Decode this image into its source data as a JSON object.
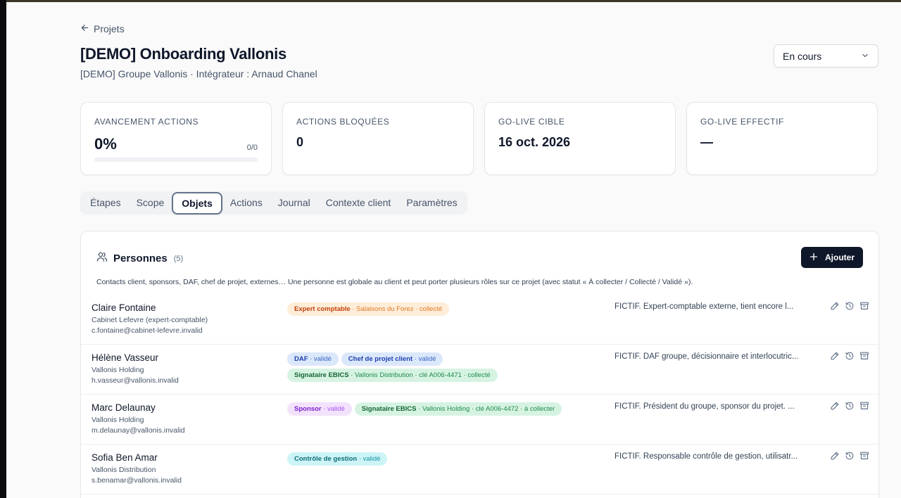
{
  "nav": {
    "back_label": "Projets"
  },
  "project": {
    "title": "[DEMO] Onboarding Vallonis",
    "subtitle": "[DEMO] Groupe Vallonis · Intégrateur : Arnaud Chanel",
    "status": "En cours"
  },
  "stats": [
    {
      "label": "Avancement actions",
      "value": "0%",
      "count": "0/0",
      "progress": 0
    },
    {
      "label": "Actions bloquées",
      "value": "0"
    },
    {
      "label": "Go-live cible",
      "value": "16 oct. 2026"
    },
    {
      "label": "Go-live effectif",
      "value": "—"
    }
  ],
  "tabs": [
    "Étapes",
    "Scope",
    "Objets",
    "Actions",
    "Journal",
    "Contexte client",
    "Paramètres"
  ],
  "active_tab": "Objets",
  "panel": {
    "title": "Personnes",
    "count": "(5)",
    "add_label": "Ajouter",
    "description": "Contacts client, sponsors, DAF, chef de projet, externes… Une personne est globale au client et peut porter plusieurs rôles sur ce projet (avec statut « À collecter / Collecté / Validé »)."
  },
  "people": [
    {
      "name": "Claire Fontaine",
      "org": "Cabinet Lefevre (expert-comptable)",
      "email": "c.fontaine@cabinet-lefevre.invalid",
      "tags": [
        {
          "role": "Expert comptable",
          "meta": " · Salaisons du Forez · collecté",
          "color": "orange"
        }
      ],
      "note": "FICTIF. Expert-comptable externe, tient encore l..."
    },
    {
      "name": "Hélène Vasseur",
      "org": "Vallonis Holding",
      "email": "h.vasseur@vallonis.invalid",
      "tags": [
        {
          "role": "DAF",
          "meta": " · validé",
          "color": "blue"
        },
        {
          "role": "Chef de projet client",
          "meta": " · validé",
          "color": "blue"
        },
        {
          "role": "Signataire EBICS",
          "meta": " · Vallonis Distribution · clé A006-4471 · collecté",
          "color": "green"
        }
      ],
      "note": "FICTIF. DAF groupe, décisionnaire et interlocutric..."
    },
    {
      "name": "Marc Delaunay",
      "org": "Vallonis Holding",
      "email": "m.delaunay@vallonis.invalid",
      "tags": [
        {
          "role": "Sponsor",
          "meta": " · validé",
          "color": "purple"
        },
        {
          "role": "Signataire EBICS",
          "meta": " · Vallonis Holding · clé A006-4472 · à collecter",
          "color": "green"
        }
      ],
      "note": "FICTIF. Président du groupe, sponsor du projet. ..."
    },
    {
      "name": "Sofia Ben Amar",
      "org": "Vallonis Distribution",
      "email": "s.benamar@vallonis.invalid",
      "tags": [
        {
          "role": "Contrôle de gestion",
          "meta": " · validé",
          "color": "cyan"
        }
      ],
      "note": "FICTIF. Responsable contrôle de gestion, utilisatr..."
    }
  ],
  "icons": {
    "back": "arrow-left-icon",
    "status": "chevron-down-icon",
    "panel": "users-icon",
    "add": "plus-icon",
    "row_actions": [
      "edit-icon",
      "history-icon",
      "archive-icon"
    ]
  }
}
